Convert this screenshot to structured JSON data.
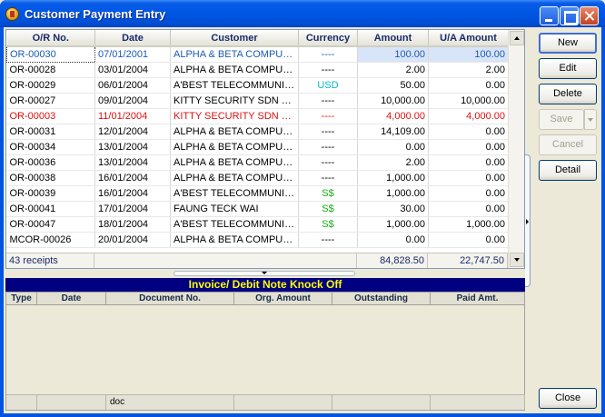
{
  "window": {
    "title": "Customer Payment Entry"
  },
  "grid": {
    "columns": [
      "O/R No.",
      "Date",
      "Customer",
      "Currency",
      "Amount",
      "U/A Amount"
    ],
    "rows": [
      {
        "or": "OR-00030",
        "date": "07/01/2001",
        "customer": "ALPHA & BETA COMPUT...",
        "currency": "----",
        "amount": "100.00",
        "ua": "100.00",
        "style": "sel"
      },
      {
        "or": "OR-00028",
        "date": "03/01/2004",
        "customer": "ALPHA & BETA COMPUT...",
        "currency": "----",
        "amount": "2.00",
        "ua": "2.00",
        "style": ""
      },
      {
        "or": "OR-00029",
        "date": "06/01/2004",
        "customer": "A'BEST TELECOMMUNIC...",
        "currency": "USD",
        "amount": "50.00",
        "ua": "0.00",
        "style": ""
      },
      {
        "or": "OR-00027",
        "date": "09/01/2004",
        "customer": "KITTY SECURITY SDN B...",
        "currency": "----",
        "amount": "10,000.00",
        "ua": "10,000.00",
        "style": ""
      },
      {
        "or": "OR-00003",
        "date": "11/01/2004",
        "customer": "KITTY SECURITY SDN B...",
        "currency": "----",
        "amount": "4,000.00",
        "ua": "4,000.00",
        "style": "red"
      },
      {
        "or": "OR-00031",
        "date": "12/01/2004",
        "customer": "ALPHA & BETA COMPUT...",
        "currency": "----",
        "amount": "14,109.00",
        "ua": "0.00",
        "style": ""
      },
      {
        "or": "OR-00034",
        "date": "13/01/2004",
        "customer": "ALPHA & BETA COMPUT...",
        "currency": "----",
        "amount": "0.00",
        "ua": "0.00",
        "style": ""
      },
      {
        "or": "OR-00036",
        "date": "13/01/2004",
        "customer": "ALPHA & BETA COMPUT...",
        "currency": "----",
        "amount": "2.00",
        "ua": "0.00",
        "style": ""
      },
      {
        "or": "OR-00038",
        "date": "16/01/2004",
        "customer": "ALPHA & BETA COMPUT...",
        "currency": "----",
        "amount": "1,000.00",
        "ua": "0.00",
        "style": ""
      },
      {
        "or": "OR-00039",
        "date": "16/01/2004",
        "customer": "A'BEST TELECOMMUNIC...",
        "currency": "S$",
        "amount": "1,000.00",
        "ua": "0.00",
        "style": ""
      },
      {
        "or": "OR-00041",
        "date": "17/01/2004",
        "customer": "FAUNG TECK WAI",
        "currency": "S$",
        "amount": "30.00",
        "ua": "0.00",
        "style": ""
      },
      {
        "or": "OR-00047",
        "date": "18/01/2004",
        "customer": "A'BEST TELECOMMUNIC...",
        "currency": "S$",
        "amount": "1,000.00",
        "ua": "1,000.00",
        "style": ""
      },
      {
        "or": "MCOR-00026",
        "date": "20/01/2004",
        "customer": "ALPHA & BETA COMPUT...",
        "currency": "----",
        "amount": "0.00",
        "ua": "0.00",
        "style": ""
      }
    ],
    "summary": {
      "count": "43 receipts",
      "amount_total": "84,828.50",
      "ua_total": "22,747.50"
    }
  },
  "knockoff": {
    "title": "Invoice/ Debit Note Knock Off",
    "columns": [
      "Type",
      "Date",
      "Document No.",
      "Org. Amount",
      "Outstanding",
      "Paid Amt."
    ],
    "footer": [
      "",
      "",
      "doc",
      "",
      "",
      ""
    ]
  },
  "buttons": {
    "new": "New",
    "edit": "Edit",
    "delete": "Delete",
    "save": "Save",
    "cancel": "Cancel",
    "detail": "Detail",
    "close": "Close"
  },
  "colors": {
    "accent": "#0054e3",
    "knockoff_bar": "#000080",
    "knockoff_text": "#ffff00",
    "cancelled_row": "#e01010",
    "usd": "#00b8c8",
    "sgd": "#10b010"
  }
}
